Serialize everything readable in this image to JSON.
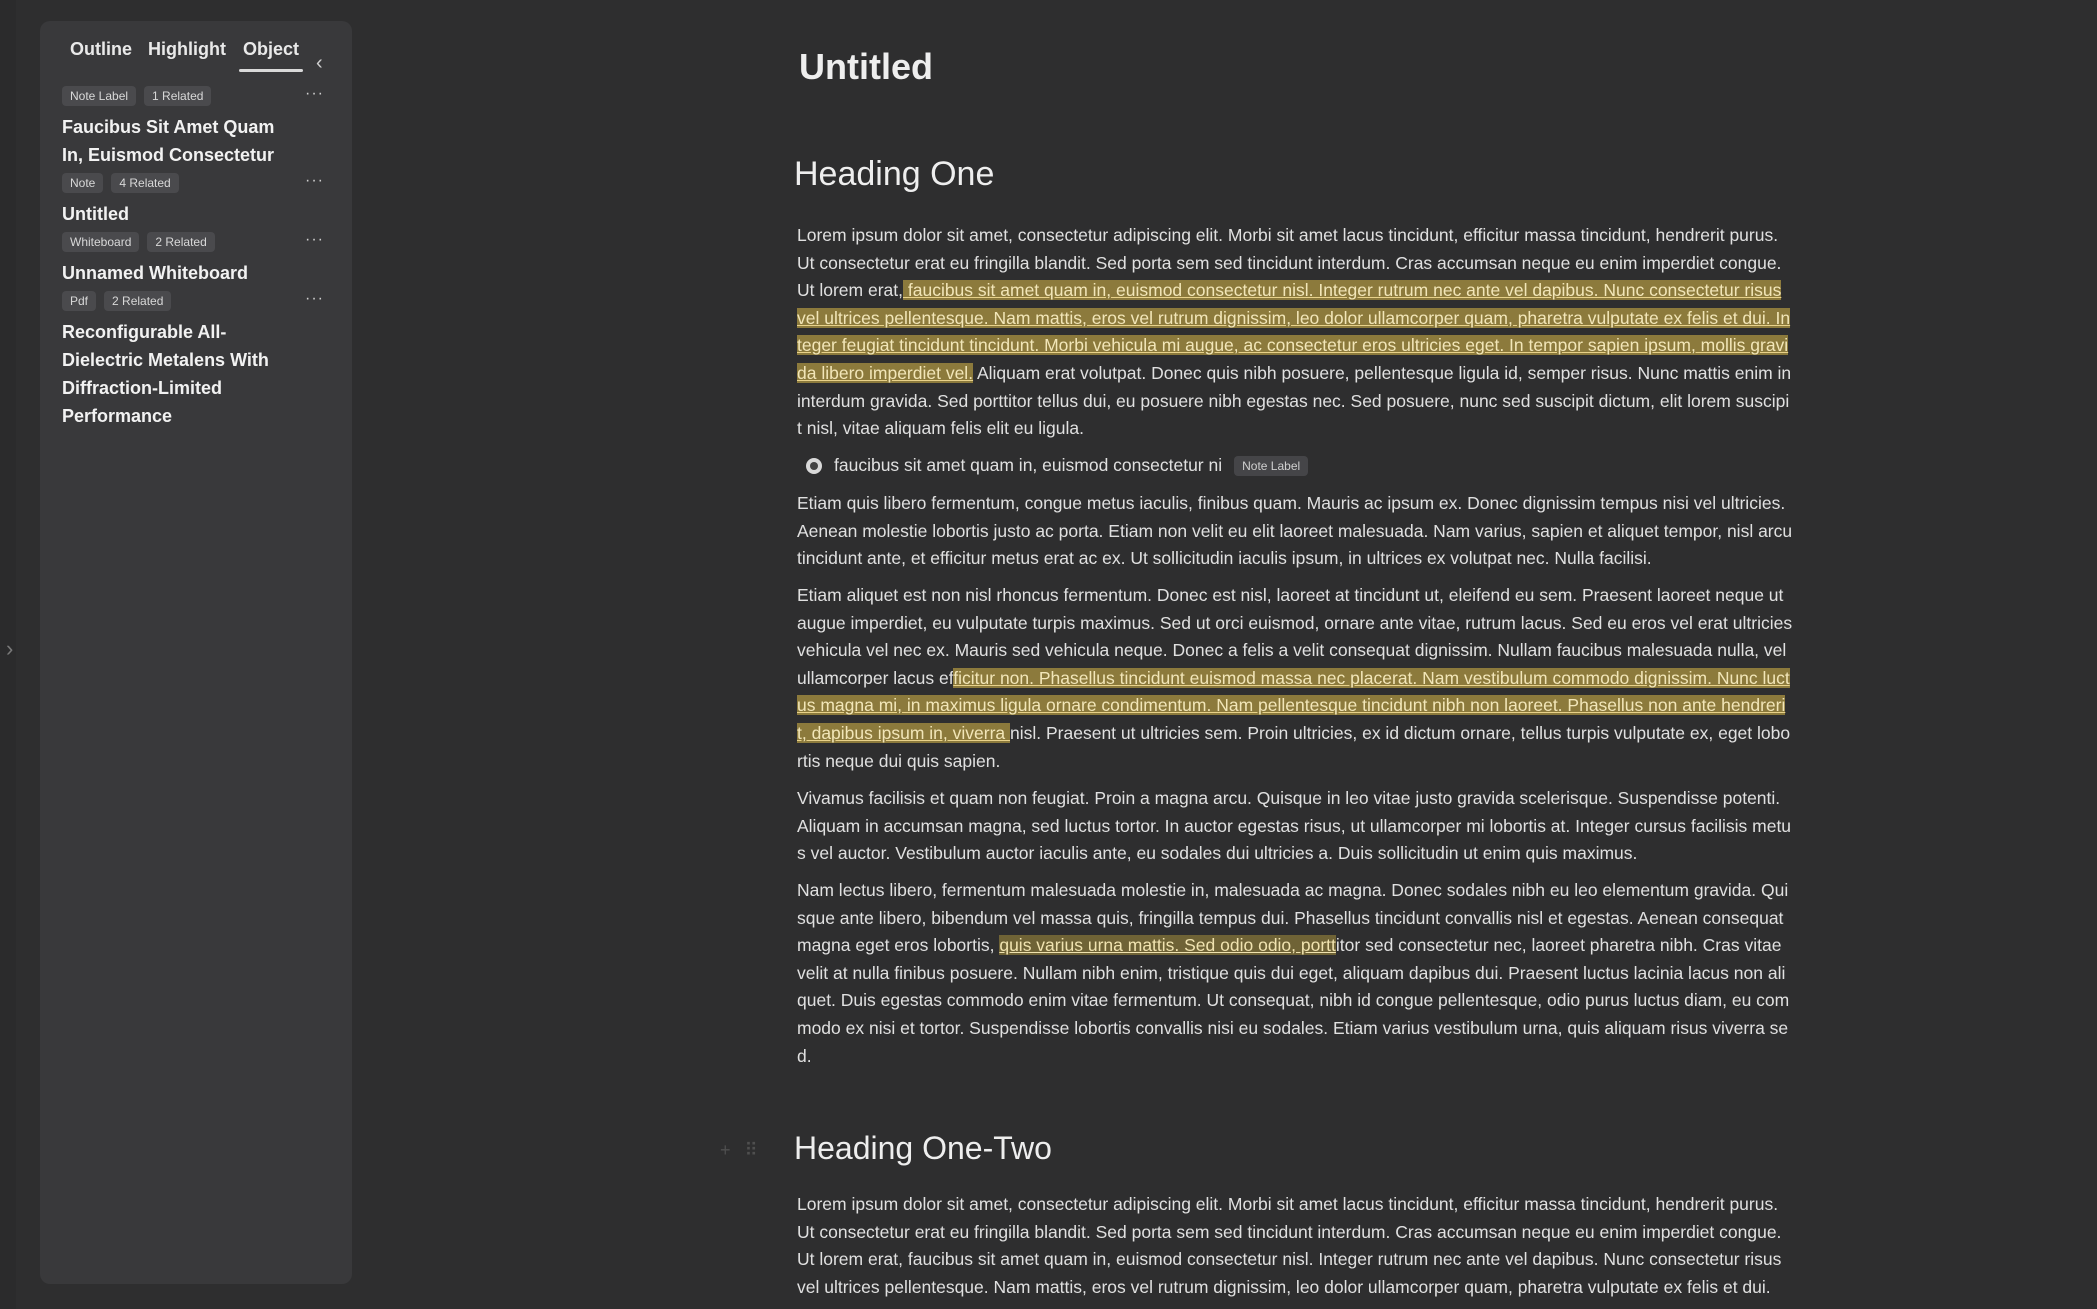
{
  "sidebar": {
    "tabs": [
      {
        "label": "Outline"
      },
      {
        "label": "Highlight"
      },
      {
        "label": "Object"
      }
    ],
    "objects": [
      {
        "type": "Note Label",
        "related": "1 Related",
        "title": "Faucibus Sit Amet Quam In, Euismod Consectetur Ni"
      },
      {
        "type": "Note",
        "related": "4 Related",
        "title": "Untitled"
      },
      {
        "type": "Whiteboard",
        "related": "2 Related",
        "title": "Unnamed Whiteboard"
      },
      {
        "type": "Pdf",
        "related": "2 Related",
        "title": "Reconfigurable All-Dielectric Metalens With Diffraction-Limited Performance"
      }
    ],
    "more_icon": "ellipsis-icon",
    "collapse_icon": "chevron-left-icon"
  },
  "editor": {
    "title": "Untitled",
    "heading1": "Heading One",
    "p1": {
      "a": "Lorem ipsum dolor sit amet, consectetur adipiscing elit. Morbi sit amet lacus tincidunt, efficitur massa tincidunt, hendrerit purus. Ut consectetur erat eu fringilla blandit. Sed porta sem sed tincidunt interdum. Cras accumsan neque eu enim imperdiet congue. Ut lorem erat,",
      "hl": " faucibus sit amet quam in, euismod consectetur nisl. Integer rutrum nec ante vel dapibus. Nunc consectetur risus vel ultrices pellentesque. Nam mattis, eros vel rutrum dignissim, leo dolor ullamcorper quam, pharetra vulputate ex felis et dui. Integer feugiat tincidunt tincidunt. Morbi vehicula mi augue, ac consectetur eros ultricies eget. In tempor sapien ipsum, mollis gravida libero imperdiet vel.",
      "b": " Aliquam erat volutpat. Donec quis nibh posuere, pellentesque ligula id, semper risus. Nunc mattis enim in interdum gravida. Sed porttitor tellus dui, eu posuere nibh egestas nec. Sed posuere, nunc sed suscipit dictum, elit lorem suscipit nisl, vitae aliquam felis elit eu ligula."
    },
    "note_ref": {
      "text": "faucibus sit amet quam in, euismod consectetur ni",
      "label": "Note Label"
    },
    "p2": "Etiam quis libero fermentum, congue metus iaculis, finibus quam. Mauris ac ipsum ex. Donec dignissim tempus nisi vel ultricies. Aenean molestie lobortis justo ac porta. Etiam non velit eu elit laoreet malesuada. Nam varius, sapien et aliquet tempor, nisl arcu tincidunt ante, et efficitur metus erat ac ex. Ut sollicitudin iaculis ipsum, in ultrices ex volutpat nec. Nulla facilisi.",
    "p3": {
      "a": "Etiam aliquet est non nisl rhoncus fermentum. Donec est nisl, laoreet at tincidunt ut, eleifend eu sem. Praesent laoreet neque ut augue imperdiet, eu vulputate turpis maximus. Sed ut orci euismod, ornare ante vitae, rutrum lacus. Sed eu eros vel erat ultricies vehicula vel nec ex. Mauris sed vehicula neque. Donec a felis a velit consequat dignissim. Nullam faucibus malesuada nulla, vel ullamcorper lacus ef",
      "hl": "ficitur non. Phasellus tincidunt euismod massa nec placerat. Nam vestibulum commodo dignissim. Nunc luctus magna mi, in maximus ligula ornare condimentum. Nam pellentesque tincidunt nibh non laoreet. Phasellus non ante hendrerit, dapibus ipsum in, viverra ",
      "b": "nisl. Praesent ut ultricies sem. Proin ultricies, ex id dictum ornare, tellus turpis vulputate ex, eget lobortis neque dui quis sapien."
    },
    "p4": "Vivamus facilisis et quam non feugiat. Proin a magna arcu. Quisque in leo vitae justo gravida scelerisque. Suspendisse potenti. Aliquam in accumsan magna, sed luctus tortor. In auctor egestas risus, ut ullamcorper mi lobortis at. Integer cursus facilisis metus vel auctor. Vestibulum auctor iaculis ante, eu sodales dui ultricies a. Duis sollicitudin ut enim quis maximus.",
    "p5": {
      "a": "Nam lectus libero, fermentum malesuada molestie in, malesuada ac magna. Donec sodales nibh eu leo elementum gravida. Quisque ante libero, bibendum vel massa quis, fringilla tempus dui. Phasellus tincidunt convallis nisl et egestas. Aenean consequat magna eget eros lobortis, ",
      "hl": "quis varius urna mattis. Sed odio odio, portt",
      "b": "itor sed consectetur nec, laoreet pharetra nibh. Cras vitae velit at nulla finibus posuere. Nullam nibh enim, tristique quis dui eget, aliquam dapibus dui. Praesent luctus lacinia lacus non aliquet. Duis egestas commodo enim vitae fermentum. Ut consequat, nibh id congue pellentesque, odio purus luctus diam, eu commodo ex nisi et tortor. Suspendisse lobortis convallis nisi eu sodales. Etiam varius vestibulum urna, quis aliquam risus viverra sed."
    },
    "heading2": "Heading One-Two",
    "p6": "Lorem ipsum dolor sit amet, consectetur adipiscing elit. Morbi sit amet lacus tincidunt, efficitur massa tincidunt, hendrerit purus. Ut consectetur erat eu fringilla blandit. Sed porta sem sed tincidunt interdum. Cras accumsan neque eu enim imperdiet congue. Ut lorem erat, faucibus sit amet quam in, euismod consectetur nisl. Integer rutrum nec ante vel dapibus. Nunc consectetur risus vel ultrices pellentesque. Nam mattis, eros vel rutrum dignissim, leo dolor ullamcorper quam, pharetra vulputate ex felis et dui."
  }
}
